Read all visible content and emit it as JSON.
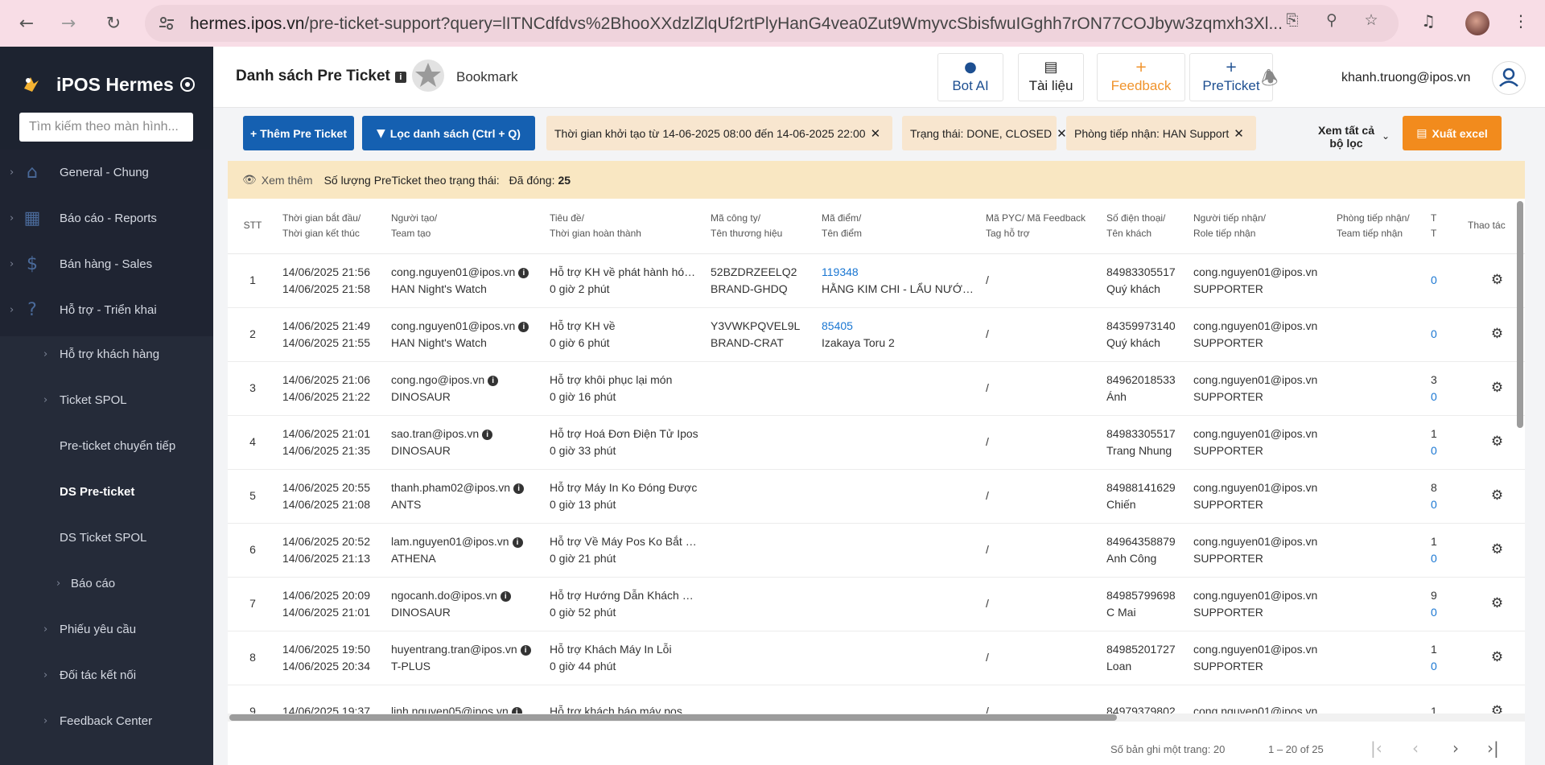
{
  "browser": {
    "url_host": "hermes.ipos.vn",
    "url_rest": "/pre-ticket-support?query=lITNCdfdvs%2BhooXXdzlZlqUf2rtPlyHanG4vea0Zut9WmyvcSbisfwuIGghh7rON77COJbyw3zqmxh3Xl..."
  },
  "sidebar": {
    "app_name": "iPOS Hermes",
    "search_placeholder": "Tìm kiếm theo màn hình...",
    "items": [
      {
        "label": "General - Chung",
        "icon": "home-icon"
      },
      {
        "label": "Báo cáo - Reports",
        "icon": "bar-chart-icon"
      },
      {
        "label": "Bán hàng - Sales",
        "icon": "dollar-icon"
      },
      {
        "label": "Hỗ trợ - Triển khai",
        "icon": "help-circle-icon"
      }
    ],
    "sub_items": [
      {
        "label": "Hỗ trợ khách hàng"
      },
      {
        "label": "Ticket SPOL"
      },
      {
        "label": "Pre-ticket chuyển tiếp"
      },
      {
        "label": "DS Pre-ticket"
      },
      {
        "label": "DS Ticket SPOL"
      },
      {
        "label": "Báo cáo"
      },
      {
        "label": "Phiếu yêu cầu"
      },
      {
        "label": "Đối tác kết nối"
      },
      {
        "label": "Feedback Center"
      }
    ]
  },
  "topbar": {
    "title": "Danh sách Pre Ticket",
    "info": "i",
    "bookmark": "Bookmark",
    "buttons": {
      "bot_ai": "Bot AI",
      "docs": "Tài liệu",
      "feedback": "Feedback",
      "preticket": "PreTicket"
    },
    "user_email": "khanh.truong@ipos.vn"
  },
  "filters": {
    "add_label": "+ Thêm Pre Ticket",
    "filter_label": "Lọc danh sách (Ctrl + Q)",
    "chips": [
      "Thời gian khởi tạo từ 14-06-2025 08:00 đến 14-06-2025 22:00",
      "Trạng thái: DONE, CLOSED",
      "Phòng tiếp nhận: HAN Support"
    ],
    "see_all": "Xem tất cả bộ lọc",
    "export": "Xuất excel"
  },
  "summary": {
    "more": "Xem thêm",
    "label": "Số lượng PreTicket theo trạng thái:",
    "closed_label": "Đã đóng:",
    "closed_count": "25"
  },
  "table": {
    "headers": {
      "stt": "STT",
      "time": [
        "Thời gian bắt đầu/",
        "Thời gian kết thúc"
      ],
      "creator": [
        "Người tạo/",
        "Team tạo"
      ],
      "subject": [
        "Tiêu đề/",
        "Thời gian hoàn thành"
      ],
      "company": [
        "Mã công ty/",
        "Tên thương hiệu"
      ],
      "store": [
        "Mã điểm/",
        "Tên điểm"
      ],
      "pyc": [
        "Mã PYC/ Mã Feedback",
        "Tag hỗ trợ"
      ],
      "phone": [
        "Số điện thoại/",
        "Tên khách"
      ],
      "receiver": [
        "Người tiếp nhận/",
        "Role tiếp nhận"
      ],
      "dept": [
        "Phòng tiếp nhận/",
        "Team tiếp nhận"
      ],
      "extra": [
        "T",
        "T"
      ],
      "actions": "Thao tác"
    },
    "rows": [
      {
        "stt": "1",
        "start": "14/06/2025 21:56",
        "end": "14/06/2025 21:58",
        "creator": "cong.nguyen01@ipos.vn",
        "team": "HAN Night's Watch",
        "subject": "Hỗ trợ KH về phát hành hóa đơn",
        "duration": "0 giờ 2 phút",
        "company": "52BZDRZEELQ2",
        "brand": "BRAND-GHDQ",
        "store_code": "119348",
        "store_name": "HẰNG KIM CHI - LẨU NƯỚNG",
        "pyc": "/",
        "phone": "84983305517",
        "customer": "Quý khách",
        "receiver": "cong.nguyen01@ipos.vn",
        "role": "SUPPORTER",
        "x1": "",
        "x2": "0"
      },
      {
        "stt": "2",
        "start": "14/06/2025 21:49",
        "end": "14/06/2025 21:55",
        "creator": "cong.nguyen01@ipos.vn",
        "team": "HAN Night's Watch",
        "subject": "Hỗ trợ KH về",
        "duration": "0 giờ 6 phút",
        "company": "Y3VWKPQVEL9L",
        "brand": "BRAND-CRAT",
        "store_code": "85405",
        "store_name": "Izakaya Toru 2",
        "pyc": "/",
        "phone": "84359973140",
        "customer": "Quý khách",
        "receiver": "cong.nguyen01@ipos.vn",
        "role": "SUPPORTER",
        "x1": "",
        "x2": "0"
      },
      {
        "stt": "3",
        "start": "14/06/2025 21:06",
        "end": "14/06/2025 21:22",
        "creator": "cong.ngo@ipos.vn",
        "team": "DINOSAUR",
        "subject": "Hỗ trợ khôi phục lại món",
        "duration": "0 giờ 16 phút",
        "company": "",
        "brand": "",
        "store_code": "",
        "store_name": "",
        "pyc": "/",
        "phone": "84962018533",
        "customer": "Ánh",
        "receiver": "cong.nguyen01@ipos.vn",
        "role": "SUPPORTER",
        "x1": "3",
        "x2": "0"
      },
      {
        "stt": "4",
        "start": "14/06/2025 21:01",
        "end": "14/06/2025 21:35",
        "creator": "sao.tran@ipos.vn",
        "team": "DINOSAUR",
        "subject": "Hỗ trợ Hoá Đơn Điện Tử Ipos",
        "duration": "0 giờ 33 phút",
        "company": "",
        "brand": "",
        "store_code": "",
        "store_name": "",
        "pyc": "/",
        "phone": "84983305517",
        "customer": "Trang Nhung",
        "receiver": "cong.nguyen01@ipos.vn",
        "role": "SUPPORTER",
        "x1": "1",
        "x2": "0"
      },
      {
        "stt": "5",
        "start": "14/06/2025 20:55",
        "end": "14/06/2025 21:08",
        "creator": "thanh.pham02@ipos.vn",
        "team": "ANTS",
        "subject": "Hỗ trợ Máy In Ko Đóng Được",
        "duration": "0 giờ 13 phút",
        "company": "",
        "brand": "",
        "store_code": "",
        "store_name": "",
        "pyc": "/",
        "phone": "84988141629",
        "customer": "Chiến",
        "receiver": "cong.nguyen01@ipos.vn",
        "role": "SUPPORTER",
        "x1": "8",
        "x2": "0"
      },
      {
        "stt": "6",
        "start": "14/06/2025 20:52",
        "end": "14/06/2025 21:13",
        "creator": "lam.nguyen01@ipos.vn",
        "team": "ATHENA",
        "subject": "Hỗ trợ Về Máy Pos Ko Bắt Được",
        "duration": "0 giờ 21 phút",
        "company": "",
        "brand": "",
        "store_code": "",
        "store_name": "",
        "pyc": "/",
        "phone": "84964358879",
        "customer": "Anh Công",
        "receiver": "cong.nguyen01@ipos.vn",
        "role": "SUPPORTER",
        "x1": "1",
        "x2": "0"
      },
      {
        "stt": "7",
        "start": "14/06/2025 20:09",
        "end": "14/06/2025 21:01",
        "creator": "ngocanh.do@ipos.vn",
        "team": "DINOSAUR",
        "subject": "Hỗ trợ Hướng Dẫn Khách Hàng",
        "duration": "0 giờ 52 phút",
        "company": "",
        "brand": "",
        "store_code": "",
        "store_name": "",
        "pyc": "/",
        "phone": "84985799698",
        "customer": "C Mai",
        "receiver": "cong.nguyen01@ipos.vn",
        "role": "SUPPORTER",
        "x1": "9",
        "x2": "0"
      },
      {
        "stt": "8",
        "start": "14/06/2025 19:50",
        "end": "14/06/2025 20:34",
        "creator": "huyentrang.tran@ipos.vn",
        "team": "T-PLUS",
        "subject": "Hỗ trợ Khách Máy In Lỗi",
        "duration": "0 giờ 44 phút",
        "company": "",
        "brand": "",
        "store_code": "",
        "store_name": "",
        "pyc": "/",
        "phone": "84985201727",
        "customer": "Loan",
        "receiver": "cong.nguyen01@ipos.vn",
        "role": "SUPPORTER",
        "x1": "1",
        "x2": "0"
      },
      {
        "stt": "9",
        "start": "14/06/2025 19:37",
        "end": "",
        "creator": "linh.nguyen05@ipos.vn",
        "team": "",
        "subject": "Hỗ trợ khách báo máy pos",
        "duration": "",
        "company": "",
        "brand": "",
        "store_code": "",
        "store_name": "",
        "pyc": "/",
        "phone": "84979379802",
        "customer": "",
        "receiver": "cong.nguyen01@ipos.vn",
        "role": "",
        "x1": "1",
        "x2": ""
      }
    ]
  },
  "pager": {
    "rows_per_page": "Số bản ghi một trang: 20",
    "range": "1 – 20 of 25"
  }
}
